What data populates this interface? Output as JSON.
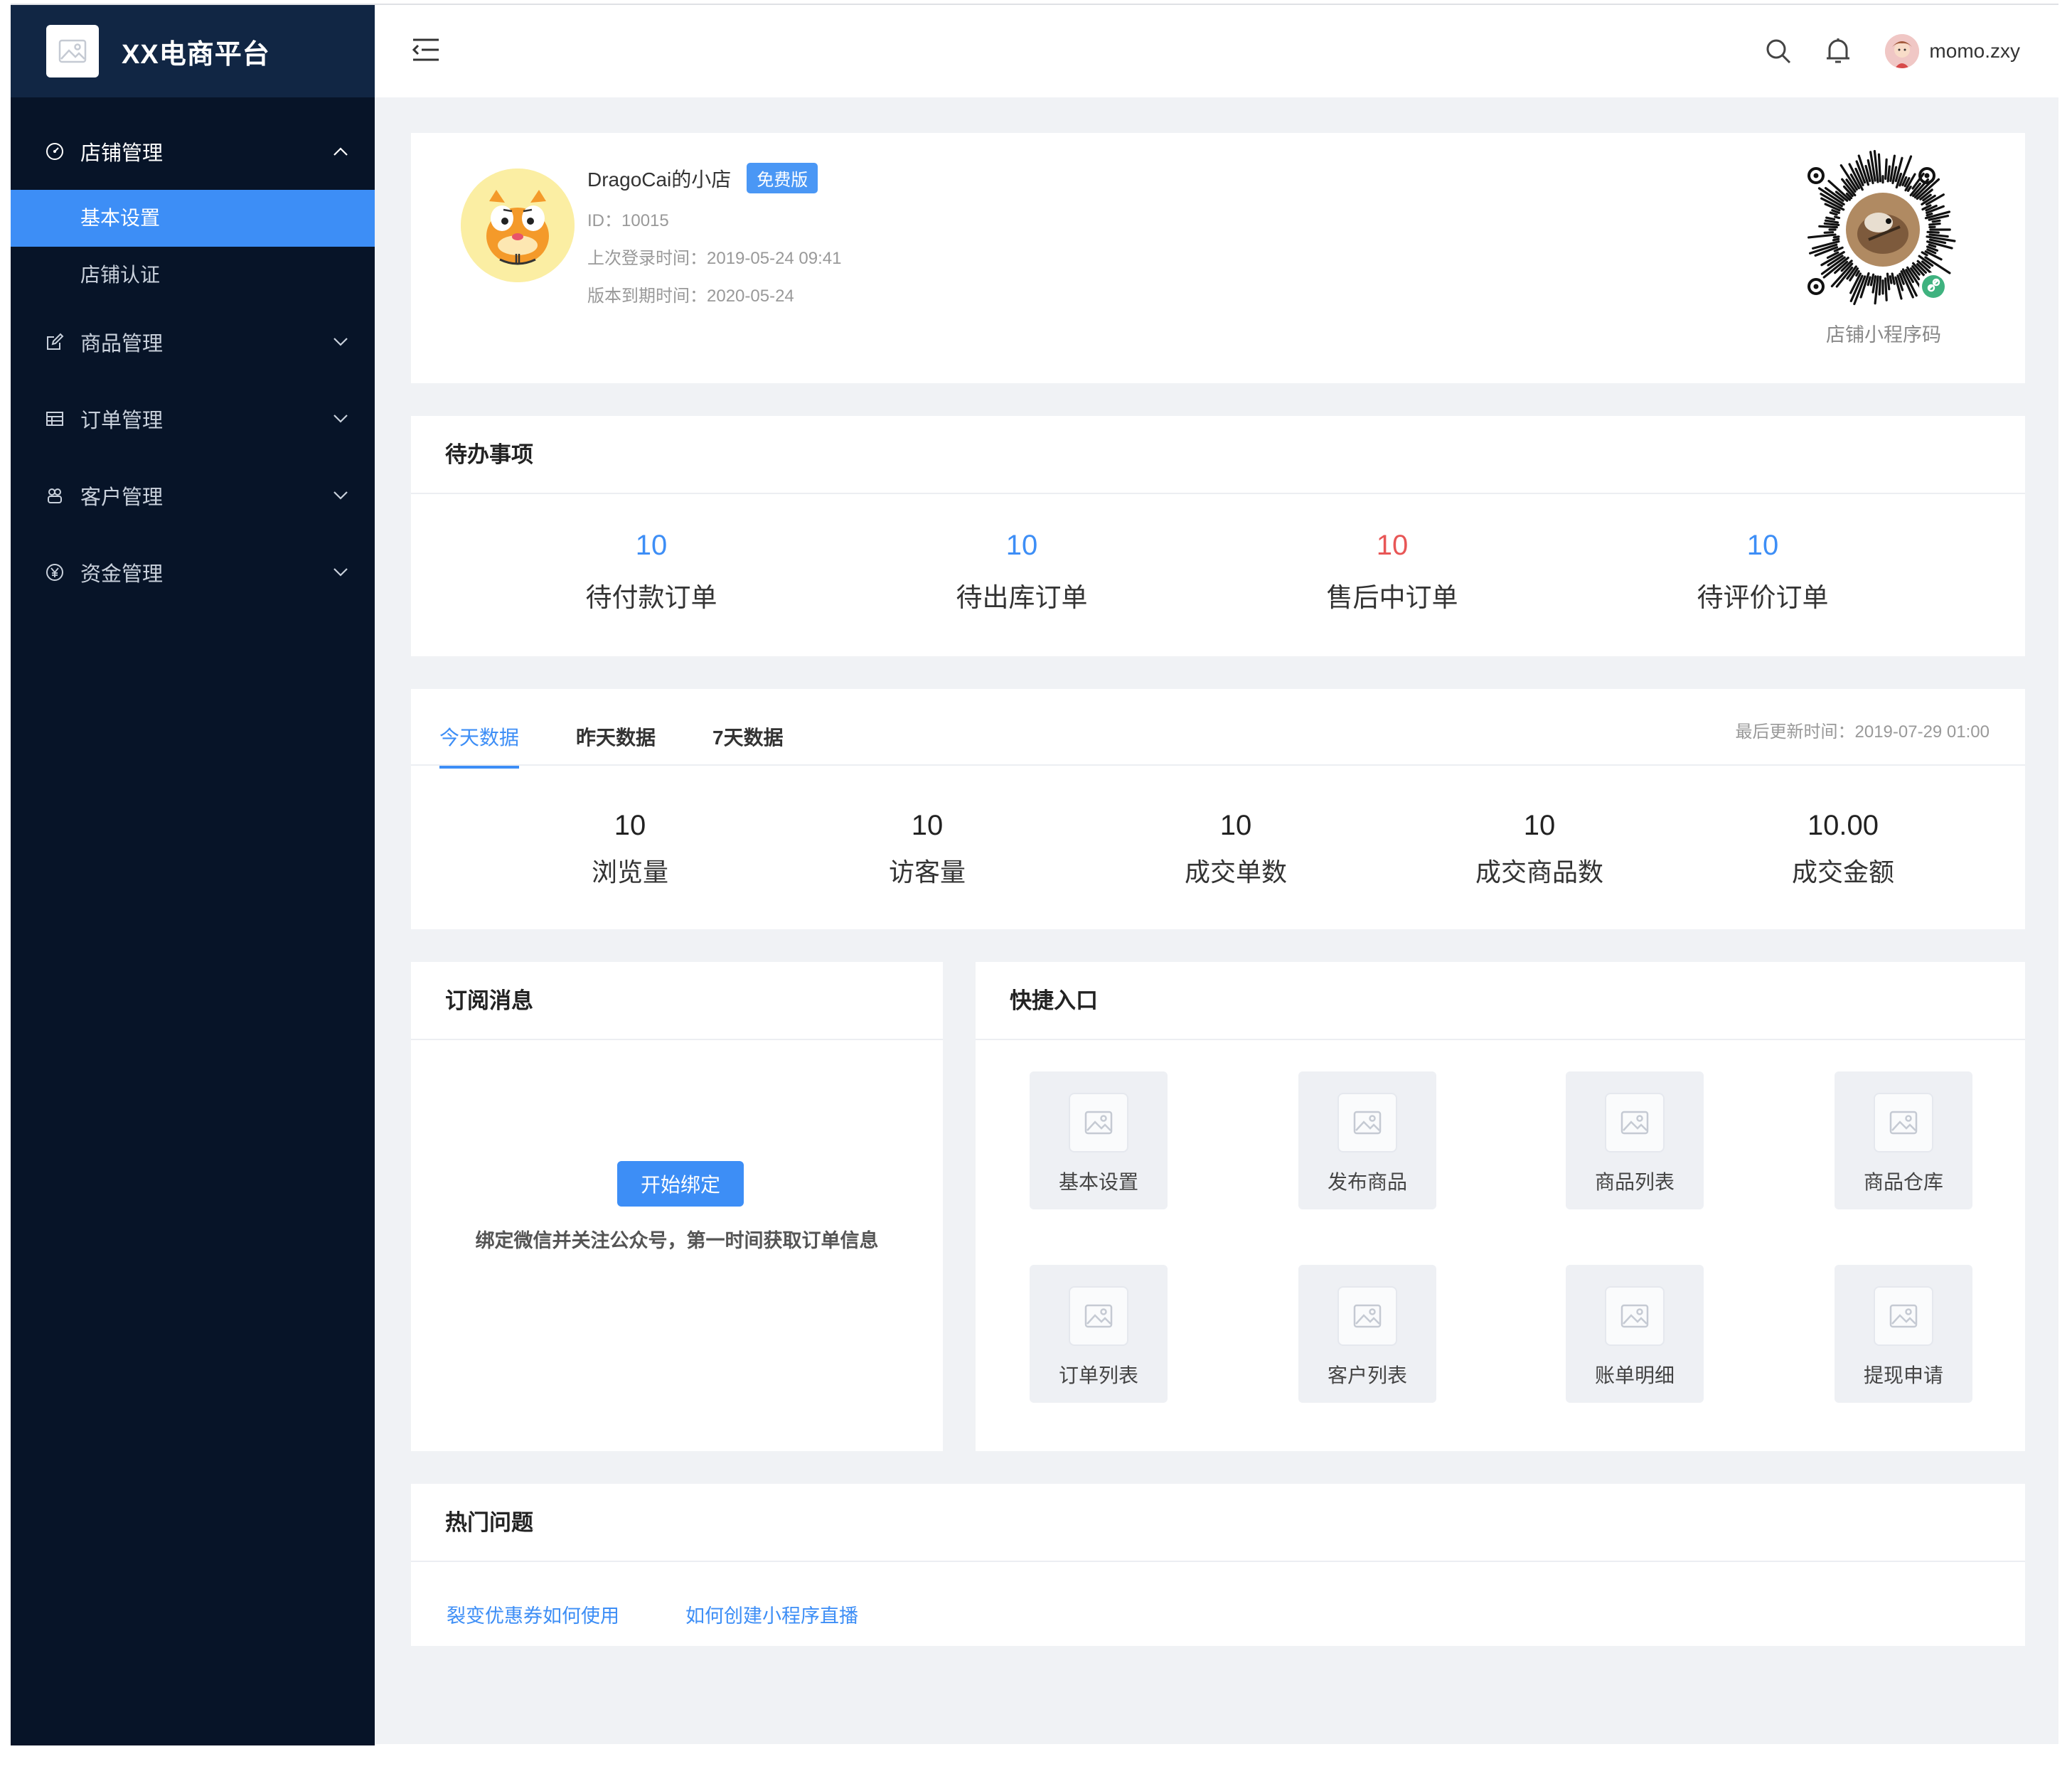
{
  "brand": {
    "title": "XX电商平台"
  },
  "sidebar": {
    "groups": [
      {
        "label": "店铺管理",
        "icon": "dashboard-icon",
        "open": true,
        "children": [
          "基本设置",
          "店铺认证"
        ]
      },
      {
        "label": "商品管理",
        "icon": "edit-icon"
      },
      {
        "label": "订单管理",
        "icon": "table-icon"
      },
      {
        "label": "客户管理",
        "icon": "users-icon"
      },
      {
        "label": "资金管理",
        "icon": "yuan-icon"
      }
    ]
  },
  "topbar": {
    "username": "momo.zxy"
  },
  "shop": {
    "name": "DragoCai的小店",
    "badge": "免费版",
    "id": "ID：10015",
    "last_login": "上次登录时间：2019-05-24 09:41",
    "expire": "版本到期时间：2020-05-24",
    "qr_label": "店铺小程序码"
  },
  "todo": {
    "title": "待办事项",
    "items": [
      {
        "value": "10",
        "label": "待付款订单"
      },
      {
        "value": "10",
        "label": "待出库订单"
      },
      {
        "value": "10",
        "label": "售后中订单"
      },
      {
        "value": "10",
        "label": "待评价订单"
      }
    ]
  },
  "stats": {
    "tabs": [
      "今天数据",
      "昨天数据",
      "7天数据"
    ],
    "active_tab": "今天数据",
    "updated": "最后更新时间：2019-07-29 01:00",
    "items": [
      {
        "value": "10",
        "label": "浏览量"
      },
      {
        "value": "10",
        "label": "访客量"
      },
      {
        "value": "10",
        "label": "成交单数"
      },
      {
        "value": "10",
        "label": "成交商品数"
      },
      {
        "value": "10.00",
        "label": "成交金额"
      }
    ]
  },
  "subscribe": {
    "title": "订阅消息",
    "button": "开始绑定",
    "desc": "绑定微信并关注公众号，第一时间获取订单信息"
  },
  "quick": {
    "title": "快捷入口",
    "items": [
      "基本设置",
      "发布商品",
      "商品列表",
      "商品仓库",
      "订单列表",
      "客户列表",
      "账单明细",
      "提现申请"
    ]
  },
  "hot": {
    "title": "热门问题",
    "links": [
      "裂变优惠券如何使用",
      "如何创建小程序直播"
    ]
  },
  "colors": {
    "accent": "#3d8ef6",
    "sidebar": "#071428",
    "alert": "#e85656"
  }
}
